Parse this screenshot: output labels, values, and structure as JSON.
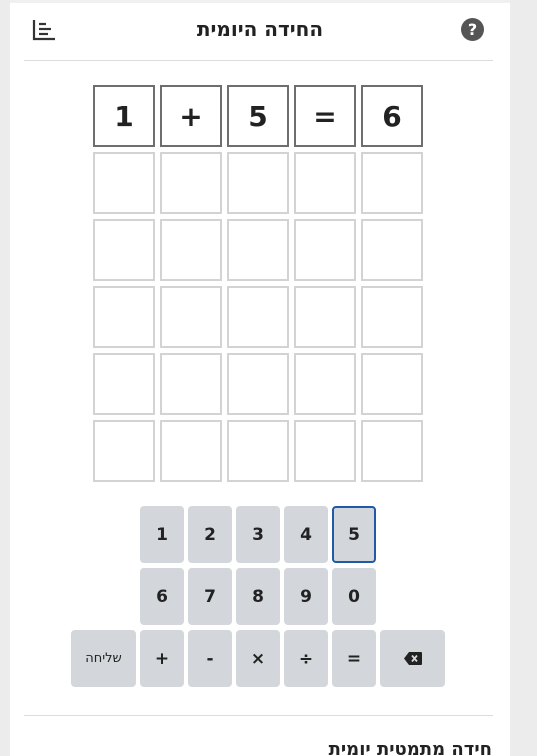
{
  "header": {
    "title": "החידה היומית",
    "help_label": "?"
  },
  "board": {
    "rows": [
      [
        "1",
        "+",
        "5",
        "=",
        "6"
      ],
      [
        "",
        "",
        "",
        "",
        ""
      ],
      [
        "",
        "",
        "",
        "",
        ""
      ],
      [
        "",
        "",
        "",
        "",
        ""
      ],
      [
        "",
        "",
        "",
        "",
        ""
      ],
      [
        "",
        "",
        "",
        "",
        ""
      ]
    ]
  },
  "keyboard": {
    "row1": [
      "1",
      "2",
      "3",
      "4",
      "5"
    ],
    "row2": [
      "6",
      "7",
      "8",
      "9",
      "0"
    ],
    "row3": [
      "שליחה",
      "+",
      "-",
      "×",
      "÷",
      "="
    ],
    "selected_key": "5",
    "backspace_icon": "backspace-icon"
  },
  "footer": {
    "section_title": "חידה מתמטית יומית"
  },
  "icons": {
    "stats": "bar-chart-icon",
    "help": "help-icon"
  }
}
